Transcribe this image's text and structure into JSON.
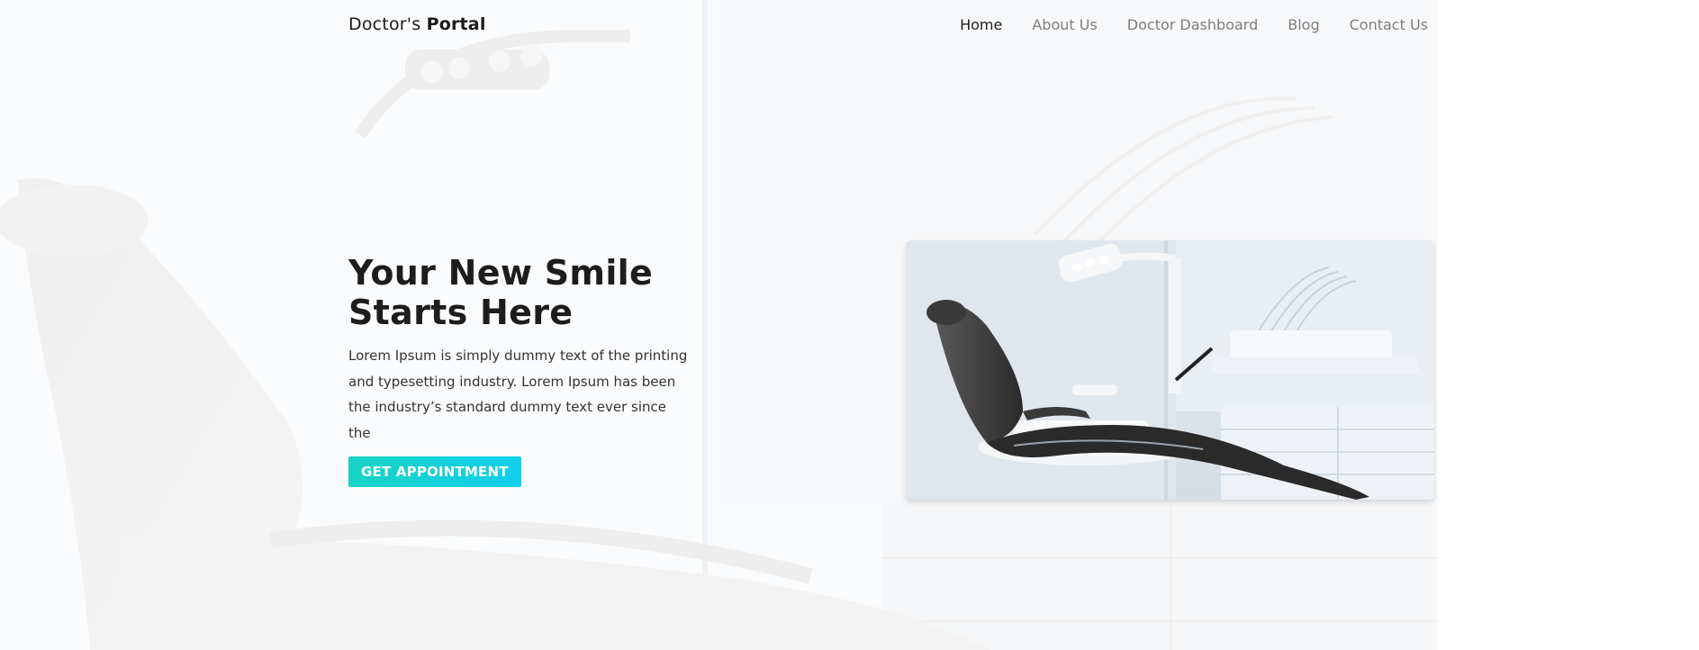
{
  "brand": {
    "prefix": "Doctor's",
    "strong": "Portal"
  },
  "nav": {
    "items": [
      {
        "label": "Home",
        "active": true
      },
      {
        "label": "About Us",
        "active": false
      },
      {
        "label": "Doctor Dashboard",
        "active": false
      },
      {
        "label": "Blog",
        "active": false
      },
      {
        "label": "Contact Us",
        "active": false
      }
    ]
  },
  "hero": {
    "title_line1": "Your New Smile",
    "title_line2": "Starts Here",
    "description": "Lorem Ipsum is simply dummy text of the printing and typesetting industry. Lorem Ipsum has been the industry’s standard dummy text ever since the",
    "cta_label": "GET APPOINTMENT",
    "image_subject": "dental-chair-photo"
  },
  "colors": {
    "accent_start": "#19d3c5",
    "accent_end": "#0fcfec",
    "nav_active": "#1d1d1d",
    "nav_inactive": "#7d7d7d",
    "text_dark": "#1d1d1d"
  }
}
